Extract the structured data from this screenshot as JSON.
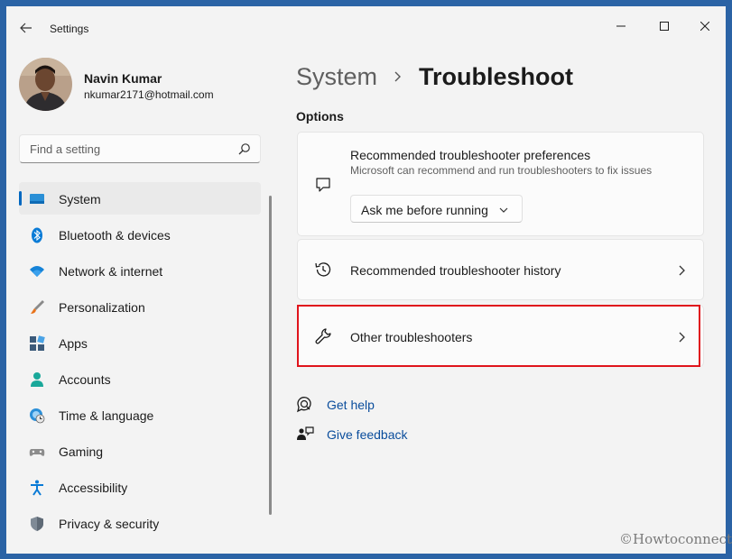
{
  "window": {
    "title": "Settings",
    "controls": [
      "minimize",
      "maximize",
      "close"
    ]
  },
  "profile": {
    "name": "Navin Kumar",
    "email": "nkumar2171@hotmail.com"
  },
  "search": {
    "placeholder": "Find a setting"
  },
  "sidebar": {
    "items": [
      {
        "label": "System",
        "icon": "system-icon",
        "selected": true
      },
      {
        "label": "Bluetooth & devices",
        "icon": "bluetooth-icon"
      },
      {
        "label": "Network & internet",
        "icon": "wifi-icon"
      },
      {
        "label": "Personalization",
        "icon": "brush-icon"
      },
      {
        "label": "Apps",
        "icon": "apps-icon"
      },
      {
        "label": "Accounts",
        "icon": "person-icon"
      },
      {
        "label": "Time & language",
        "icon": "globe-clock-icon"
      },
      {
        "label": "Gaming",
        "icon": "gamepad-icon"
      },
      {
        "label": "Accessibility",
        "icon": "accessibility-icon"
      },
      {
        "label": "Privacy & security",
        "icon": "shield-icon"
      }
    ]
  },
  "breadcrumb": {
    "parent": "System",
    "current": "Troubleshoot"
  },
  "options_label": "Options",
  "cards": {
    "preferences": {
      "title": "Recommended troubleshooter preferences",
      "description": "Microsoft can recommend and run troubleshooters to fix issues",
      "dropdown_value": "Ask me before running"
    },
    "history": {
      "title": "Recommended troubleshooter history"
    },
    "other": {
      "title": "Other troubleshooters"
    }
  },
  "links": {
    "get_help": "Get help",
    "give_feedback": "Give feedback"
  },
  "watermark": "©Howtoconnect",
  "colors": {
    "accent": "#0067c0",
    "link": "#0a4d9c",
    "highlight_border": "#e0141c"
  }
}
